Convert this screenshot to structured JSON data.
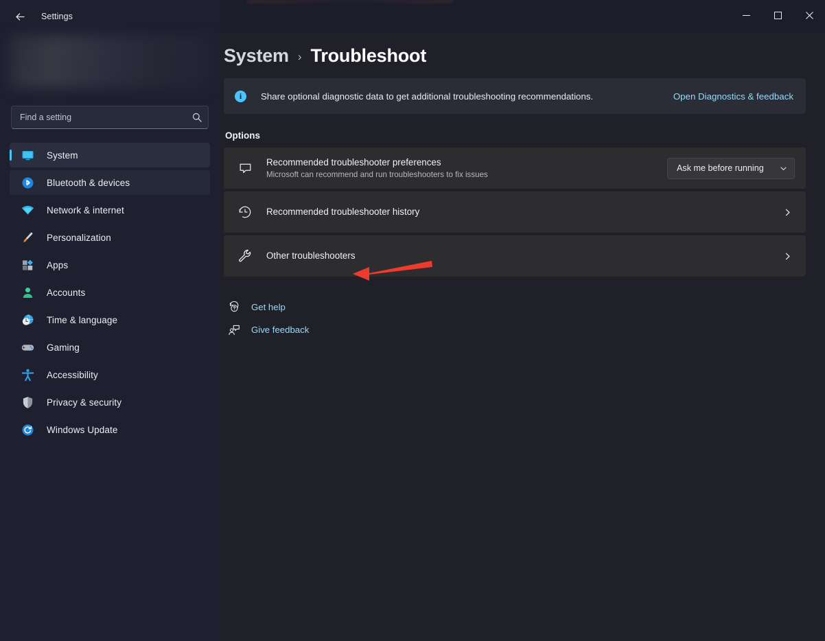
{
  "window": {
    "app_title": "Settings",
    "back_icon": "back-arrow-icon",
    "minimize_label": "–",
    "maximize_label": "□",
    "close_label": "✕"
  },
  "sidebar": {
    "search": {
      "placeholder": "Find a setting",
      "value": "",
      "icon": "search-icon"
    },
    "items": [
      {
        "label": "System",
        "icon": "monitor-icon",
        "selected": true,
        "hover": false
      },
      {
        "label": "Bluetooth & devices",
        "icon": "bluetooth-icon",
        "selected": false,
        "hover": true
      },
      {
        "label": "Network & internet",
        "icon": "wifi-icon",
        "selected": false,
        "hover": false
      },
      {
        "label": "Personalization",
        "icon": "paintbrush-icon",
        "selected": false,
        "hover": false
      },
      {
        "label": "Apps",
        "icon": "apps-grid-icon",
        "selected": false,
        "hover": false
      },
      {
        "label": "Accounts",
        "icon": "person-icon",
        "selected": false,
        "hover": false
      },
      {
        "label": "Time & language",
        "icon": "clock-globe-icon",
        "selected": false,
        "hover": false
      },
      {
        "label": "Gaming",
        "icon": "gamepad-icon",
        "selected": false,
        "hover": false
      },
      {
        "label": "Accessibility",
        "icon": "accessibility-icon",
        "selected": false,
        "hover": false
      },
      {
        "label": "Privacy & security",
        "icon": "shield-icon",
        "selected": false,
        "hover": false
      },
      {
        "label": "Windows Update",
        "icon": "update-refresh-icon",
        "selected": false,
        "hover": false
      }
    ]
  },
  "main": {
    "breadcrumb": {
      "parent": "System",
      "separator": "›",
      "current": "Troubleshoot"
    },
    "banner": {
      "icon": "info-icon",
      "icon_glyph": "i",
      "text": "Share optional diagnostic data to get additional troubleshooting recommendations.",
      "link_label": "Open Diagnostics & feedback"
    },
    "section_title": "Options",
    "cards": [
      {
        "icon": "chat-bubble-icon",
        "title": "Recommended troubleshooter preferences",
        "subtitle": "Microsoft can recommend and run troubleshooters to fix issues",
        "control": "dropdown",
        "dropdown_value": "Ask me before running",
        "dropdown_caret": "chevron-down-icon"
      },
      {
        "icon": "history-clock-icon",
        "title": "Recommended troubleshooter history",
        "subtitle": "",
        "control": "chevron",
        "chevron": "chevron-right-icon"
      },
      {
        "icon": "wrench-icon",
        "title": "Other troubleshooters",
        "subtitle": "",
        "control": "chevron",
        "chevron": "chevron-right-icon"
      }
    ],
    "links": [
      {
        "label": "Get help",
        "icon": "help-question-icon"
      },
      {
        "label": "Give feedback",
        "icon": "feedback-person-icon"
      }
    ]
  },
  "annotation": {
    "type": "arrow-pointer",
    "color": "#ee3b2e",
    "points_to": "Other troubleshooters"
  },
  "colors": {
    "accent": "#4cc2ff",
    "link": "#9bd9f5",
    "sidebar_bg": "#1e2030",
    "main_bg": "#202028",
    "card_bg": "#2d2c2f",
    "banner_bg": "#2a2c36",
    "annotation_red": "#ee3b2e"
  }
}
